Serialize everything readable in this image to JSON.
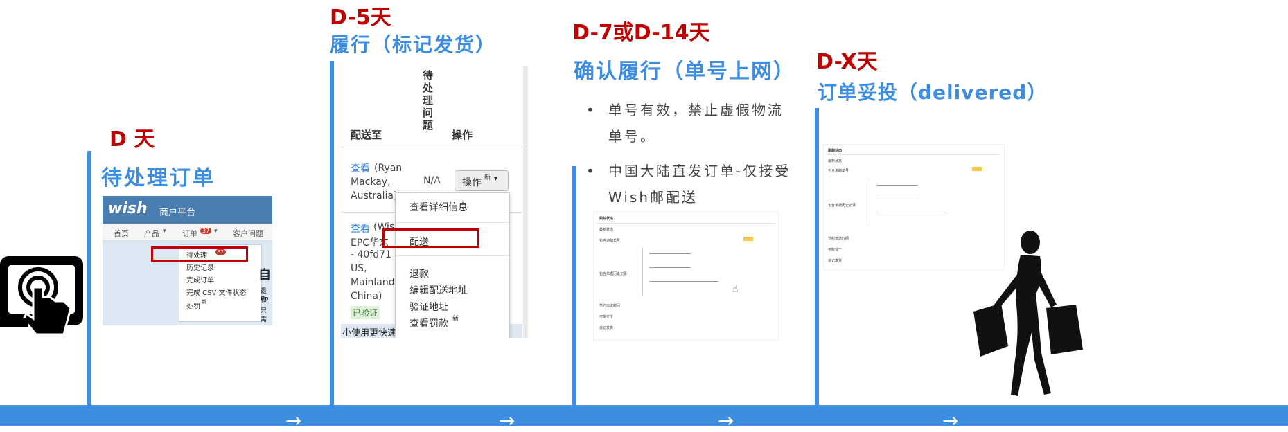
{
  "stage_d": {
    "day": "D 天",
    "title": "待处理订单"
  },
  "stage_d5": {
    "day": "D-5天",
    "title": "履行（标记发货）"
  },
  "stage_d7": {
    "day": "D-7或D-14天",
    "title": "确认履行（单号上网）",
    "bullets": [
      "单号有效，禁止虚假物流单号。",
      "中国大陆直发订单-仅接受Wish邮配送"
    ]
  },
  "stage_dx": {
    "day": "D-X天",
    "title": "订单妥投（delivered）"
  },
  "wish_ui": {
    "logo": "wish",
    "platform": "商户平台",
    "nav": [
      "首页",
      "产品",
      "订单",
      "客户问题"
    ],
    "order_badge": "37",
    "dropdown": [
      "待处理",
      "历史记录",
      "完成订单",
      "完成 CSV 文件状态",
      "处罚"
    ],
    "pending_badge": "37",
    "new_tag": "新",
    "side_text": [
      "自",
      "最和",
      "Bo",
      "只需"
    ]
  },
  "orders_ui": {
    "col_ship_to": "配送至",
    "col_issue": "待处理问题",
    "col_action": "操作",
    "row1_link": "查看",
    "row1_addr": "(Ryan Mackay, Australia)",
    "row1_issue": "N/A",
    "action_button": "操作",
    "new_tag": "新",
    "row2_link": "查看",
    "row2_addr": [
      "(Wis",
      "EPC华东",
      "- 40fd71 -",
      "US,",
      "Mainland",
      "China)"
    ],
    "verified": "已验证",
    "bottom_cut": "小使用更快速",
    "menu": [
      "查看详细信息",
      "配送",
      "退款",
      "编辑配送地址",
      "验证地址",
      "查看罚款"
    ]
  },
  "tracking_ui": {
    "heading": "跟踪状态",
    "labels": [
      "最新状态",
      "包含追踪单号",
      "包含单据历史记录",
      "节约运送时间",
      "可能位于",
      "追记发货"
    ]
  },
  "colors": {
    "accent_blue": "#3d8ee0",
    "accent_red": "#c00000",
    "wish_header": "#4a7db0",
    "highlight_box": "#c00000"
  }
}
